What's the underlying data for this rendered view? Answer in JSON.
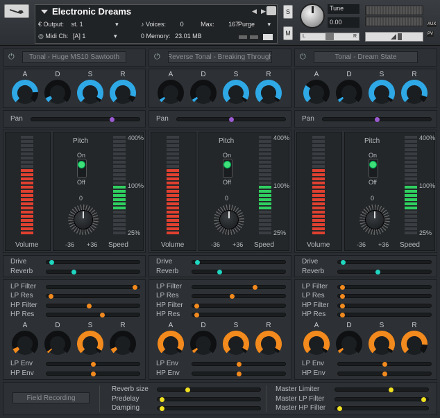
{
  "header": {
    "instrument_name": "Electronic Dreams",
    "output_label": "Output:",
    "output_value": "st. 1",
    "voices_label": "Voices:",
    "voices_value": "0",
    "max_label": "Max:",
    "max_value": "167",
    "purge_label": "Purge",
    "midi_label": "Midi Ch:",
    "midi_value": "[A]  1",
    "memory_label": "Memory:",
    "memory_value": "23.01 MB",
    "memory_prefix": "0",
    "s_label": "S",
    "m_label": "M",
    "tune_label": "Tune",
    "tune_value": "0.00",
    "l_label": "L",
    "r_label": "R",
    "aux_label": "AUX",
    "pv_label": "PV"
  },
  "columns": [
    {
      "preset": "Tonal - Huge MS10 Sawtooth",
      "adsr_top": [
        0.82,
        0.08,
        0.95,
        0.9
      ],
      "pan": 0.75,
      "drive": 0.03,
      "reverb": 0.28,
      "lp_filter": 0.97,
      "lp_res": 0.02,
      "hp_filter": 0.45,
      "hp_res": 0.6,
      "adsr_bottom": [
        0.08,
        0.03,
        0.95,
        0.08
      ],
      "lp_env": 0.5,
      "hp_env": 0.5
    },
    {
      "preset": "Reverse Tonal - Breaking Through",
      "adsr_top": [
        0.05,
        0.05,
        0.95,
        0.95
      ],
      "pan": 0.5,
      "drive": 0.03,
      "reverb": 0.28,
      "lp_filter": 0.68,
      "lp_res": 0.42,
      "hp_filter": 0.02,
      "hp_res": 0.02,
      "adsr_bottom": [
        0.95,
        0.05,
        0.95,
        0.95
      ],
      "lp_env": 0.5,
      "hp_env": 0.5
    },
    {
      "preset": "Tonal - Dream State",
      "adsr_top": [
        0.3,
        0.05,
        0.95,
        0.9
      ],
      "pan": 0.5,
      "drive": 0.03,
      "reverb": 0.42,
      "lp_filter": 0.02,
      "lp_res": 0.02,
      "hp_filter": 0.02,
      "hp_res": 0.02,
      "adsr_bottom": [
        0.95,
        0.05,
        0.95,
        0.85
      ],
      "lp_env": 0.5,
      "hp_env": 0.5
    }
  ],
  "labels": {
    "a": "A",
    "d": "D",
    "s": "S",
    "r": "R",
    "pan": "Pan",
    "pitch": "Pitch",
    "on": "On",
    "off": "Off",
    "pitch_value": "0",
    "minus36": "-36",
    "plus36": "+36",
    "volume": "Volume",
    "speed": "Speed",
    "p400": "400%",
    "p100": "100%",
    "p25": "25%",
    "drive": "Drive",
    "reverb": "Reverb",
    "lp_filter": "LP Filter",
    "lp_res": "LP Res",
    "hp_filter": "HP Filter",
    "hp_res": "HP Res",
    "lp_env": "LP Env",
    "hp_env": "HP Env"
  },
  "footer": {
    "field_recording": "Field Recording",
    "reverb_size": "Reverb size",
    "predelay": "Predelay",
    "damping": "Damping",
    "master_limiter": "Master Limiter",
    "master_lp": "Master LP Filter",
    "master_hp": "Master HP Filter",
    "values": {
      "reverb_size": 0.28,
      "predelay": 0.02,
      "damping": 0.02,
      "master_limiter": 0.6,
      "master_lp": 0.97,
      "master_hp": 0.02
    }
  },
  "colors": {
    "blue": "#2fa8e6",
    "orange": "#f28a1e",
    "purple": "#9b59d0",
    "cyan": "#1fd6c0",
    "yellow": "#f0e020",
    "red_led": "#e04030",
    "green_led": "#30d060"
  }
}
